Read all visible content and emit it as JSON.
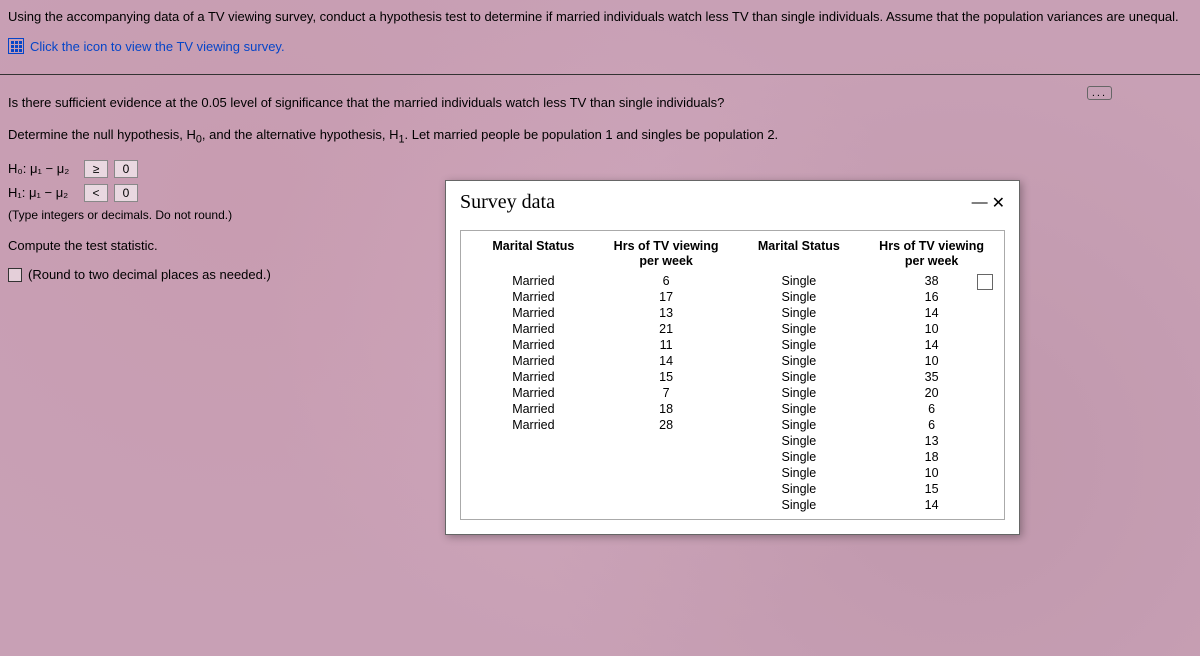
{
  "question": "Using the accompanying data of a TV viewing survey, conduct a hypothesis test to determine if married individuals watch less TV than single individuals. Assume that the population variances are unequal.",
  "link": {
    "text": "Click the icon to view the TV viewing survey."
  },
  "more_dots": "...",
  "prompt1": "Is there sufficient evidence at the 0.05 level of significance that the married individuals watch less TV than single individuals?",
  "prompt2_prefix": "Determine the null hypothesis, H",
  "prompt2_sub0": "0",
  "prompt2_mid": ", and the alternative hypothesis, H",
  "prompt2_sub1": "1",
  "prompt2_suffix": ". Let married people be population 1 and singles be population 2.",
  "h0": {
    "label": "H₀:  μ₁ − μ₂",
    "op": "≥",
    "val": "0"
  },
  "h1": {
    "label": "H₁:  μ₁ − μ₂",
    "op": "<",
    "val": "0"
  },
  "hint1": "(Type integers or decimals. Do not round.)",
  "compute": "Compute the test statistic.",
  "hint2": "(Round to two decimal places as needed.)",
  "dialog": {
    "title": "Survey data",
    "close_dash": "—",
    "close_x": "✕",
    "headers": {
      "col1": "Marital Status",
      "col2": "Hrs of TV viewing per week",
      "col3": "Marital Status",
      "col4": "Hrs of TV viewing per week"
    },
    "rows": [
      {
        "c1": "Married",
        "c2": "6",
        "c3": "Single",
        "c4": "38"
      },
      {
        "c1": "Married",
        "c2": "17",
        "c3": "Single",
        "c4": "16"
      },
      {
        "c1": "Married",
        "c2": "13",
        "c3": "Single",
        "c4": "14"
      },
      {
        "c1": "Married",
        "c2": "21",
        "c3": "Single",
        "c4": "10"
      },
      {
        "c1": "Married",
        "c2": "11",
        "c3": "Single",
        "c4": "14"
      },
      {
        "c1": "Married",
        "c2": "14",
        "c3": "Single",
        "c4": "10"
      },
      {
        "c1": "Married",
        "c2": "15",
        "c3": "Single",
        "c4": "35"
      },
      {
        "c1": "Married",
        "c2": "7",
        "c3": "Single",
        "c4": "20"
      },
      {
        "c1": "Married",
        "c2": "18",
        "c3": "Single",
        "c4": "6"
      },
      {
        "c1": "Married",
        "c2": "28",
        "c3": "Single",
        "c4": "6"
      },
      {
        "c1": "",
        "c2": "",
        "c3": "Single",
        "c4": "13"
      },
      {
        "c1": "",
        "c2": "",
        "c3": "Single",
        "c4": "18"
      },
      {
        "c1": "",
        "c2": "",
        "c3": "Single",
        "c4": "10"
      },
      {
        "c1": "",
        "c2": "",
        "c3": "Single",
        "c4": "15"
      },
      {
        "c1": "",
        "c2": "",
        "c3": "Single",
        "c4": "14"
      }
    ]
  }
}
